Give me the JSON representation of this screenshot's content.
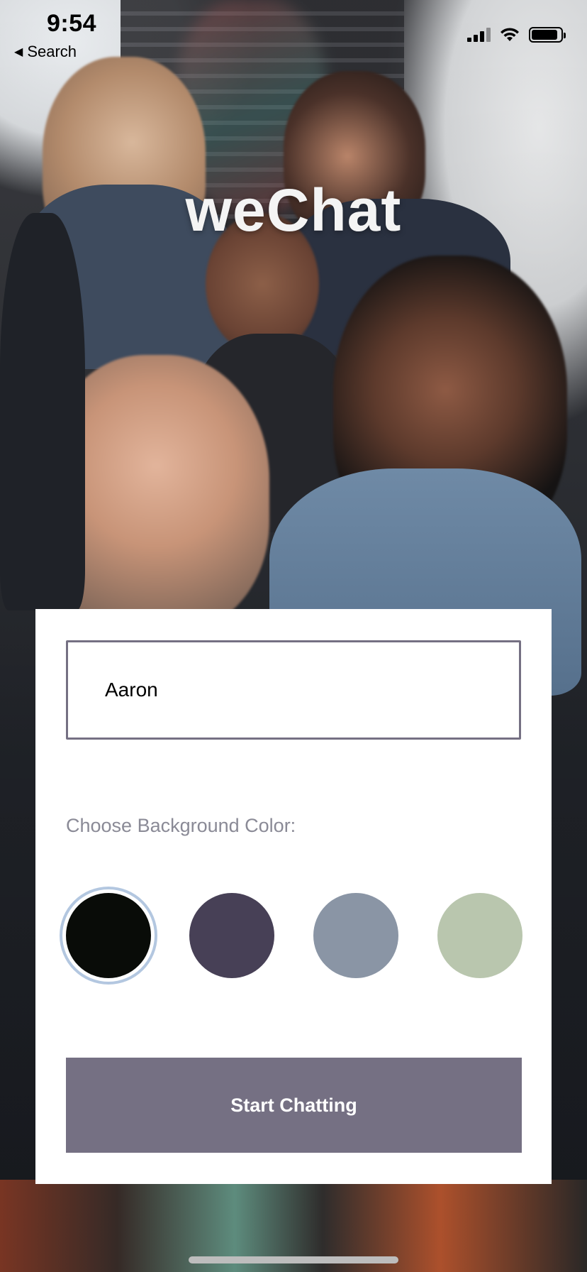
{
  "status_bar": {
    "time": "9:54",
    "back_label": "Search",
    "battery_level": 0.9
  },
  "app": {
    "title": "weChat"
  },
  "form": {
    "name_value": "Aaron",
    "background_label": "Choose Background Color:",
    "colors": [
      {
        "hex": "#090C08",
        "selected": true
      },
      {
        "hex": "#474056",
        "selected": false
      },
      {
        "hex": "#8A95A5",
        "selected": false
      },
      {
        "hex": "#B9C6AE",
        "selected": false
      }
    ],
    "selected_ring_color": "#B3C7E0",
    "start_button_label": "Start Chatting",
    "button_color": "#757083"
  },
  "icons": {
    "back": "back-arrow-icon",
    "signal": "cellular-signal-icon",
    "wifi": "wifi-icon",
    "battery": "battery-icon"
  }
}
